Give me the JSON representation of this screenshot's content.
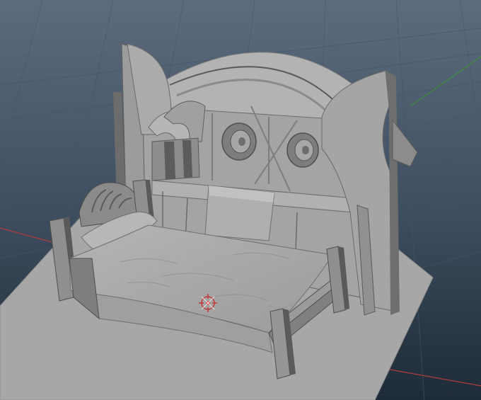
{
  "viewport": {
    "background_top": "#5b6b7b",
    "background_bottom": "#1f2c3a",
    "grid_color": "#3a4a5a",
    "axis_x_color": "#a83a3a",
    "axis_z_color": "#3a8a3a"
  },
  "model": {
    "base_color": "#a9aaa9",
    "shadow_color": "#6d6e6d",
    "dark_color": "#4a4b4a"
  },
  "manipulator": {
    "icon": "pivot-target-icon",
    "color": "#c03a3a"
  }
}
